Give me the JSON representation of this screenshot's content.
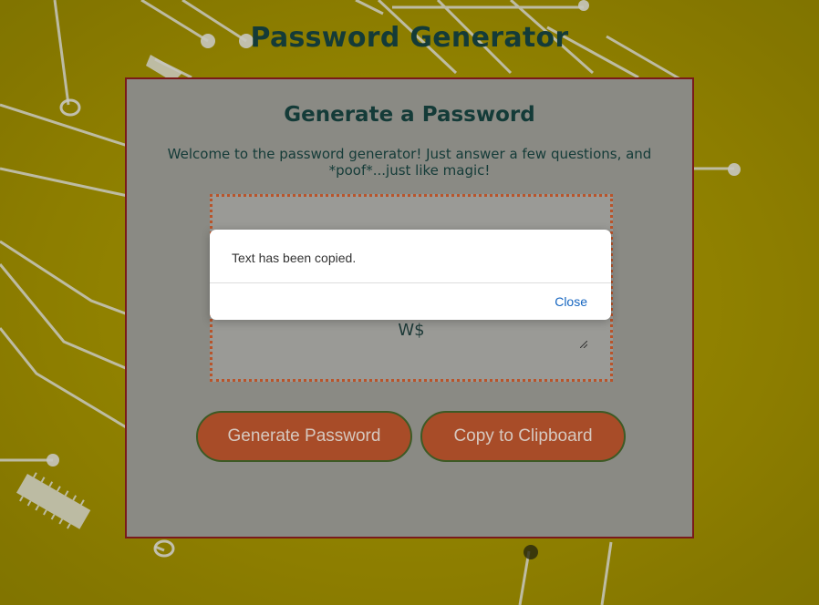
{
  "page": {
    "title": "Password Generator"
  },
  "card": {
    "title": "Generate a Password",
    "description": "Welcome to the password generator! Just answer a few questions, and *poof*...just like magic!",
    "password_value": "W$"
  },
  "buttons": {
    "generate_label": "Generate Password",
    "copy_label": "Copy to Clipboard"
  },
  "dialog": {
    "message": "Text has been copied.",
    "close_label": "Close"
  },
  "colors": {
    "background": "#9a8a00",
    "card_bg": "#8a8a84",
    "card_border": "#7a1a1a",
    "title_text": "#143b38",
    "button_bg": "#a84c28",
    "button_border": "#3d5a25",
    "dotted_border": "#b8542b",
    "link_blue": "#1565c0"
  }
}
